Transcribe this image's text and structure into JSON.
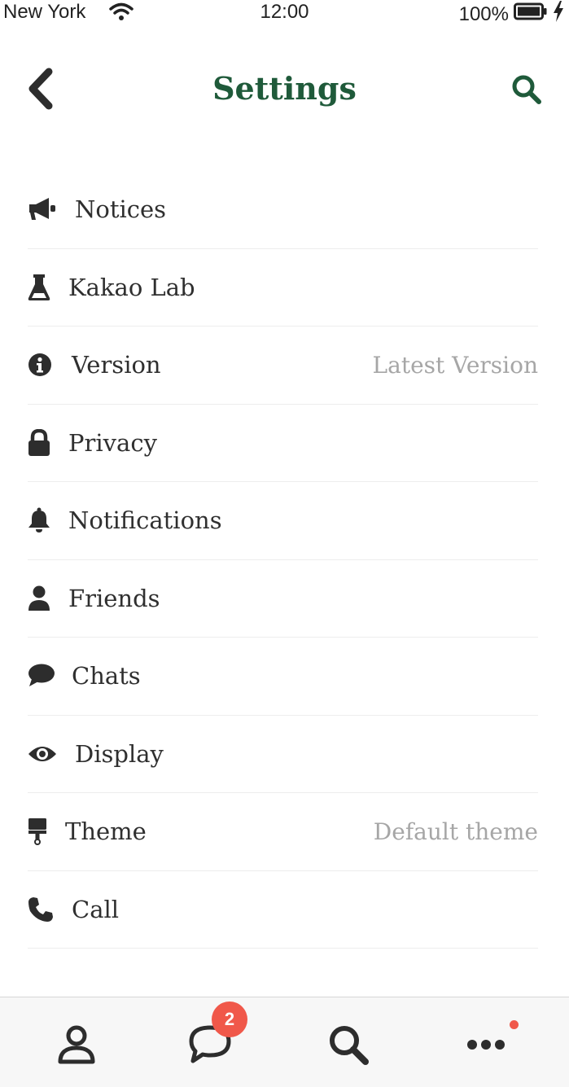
{
  "status_bar": {
    "carrier": "New York",
    "time": "12:00",
    "battery": "100%"
  },
  "header": {
    "title": "Settings"
  },
  "settings": [
    {
      "icon": "megaphone-icon",
      "label": "Notices",
      "value": ""
    },
    {
      "icon": "flask-icon",
      "label": "Kakao Lab",
      "value": ""
    },
    {
      "icon": "info-icon",
      "label": "Version",
      "value": "Latest Version"
    },
    {
      "icon": "lock-icon",
      "label": "Privacy",
      "value": ""
    },
    {
      "icon": "bell-icon",
      "label": "Notifications",
      "value": ""
    },
    {
      "icon": "user-icon",
      "label": "Friends",
      "value": ""
    },
    {
      "icon": "chat-bubble-icon",
      "label": "Chats",
      "value": ""
    },
    {
      "icon": "eye-icon",
      "label": "Display",
      "value": ""
    },
    {
      "icon": "paint-roller-icon",
      "label": "Theme",
      "value": "Default theme"
    },
    {
      "icon": "phone-icon",
      "label": "Call",
      "value": ""
    }
  ],
  "tab_bar": {
    "tabs": [
      {
        "icon": "person-icon"
      },
      {
        "icon": "chat-icon",
        "badge": "2"
      },
      {
        "icon": "search-icon"
      },
      {
        "icon": "more-icon",
        "dot": true
      }
    ]
  },
  "colors": {
    "title": "#1f5a3a",
    "badge": "#f0584a",
    "value_text": "#a6a6a6"
  }
}
